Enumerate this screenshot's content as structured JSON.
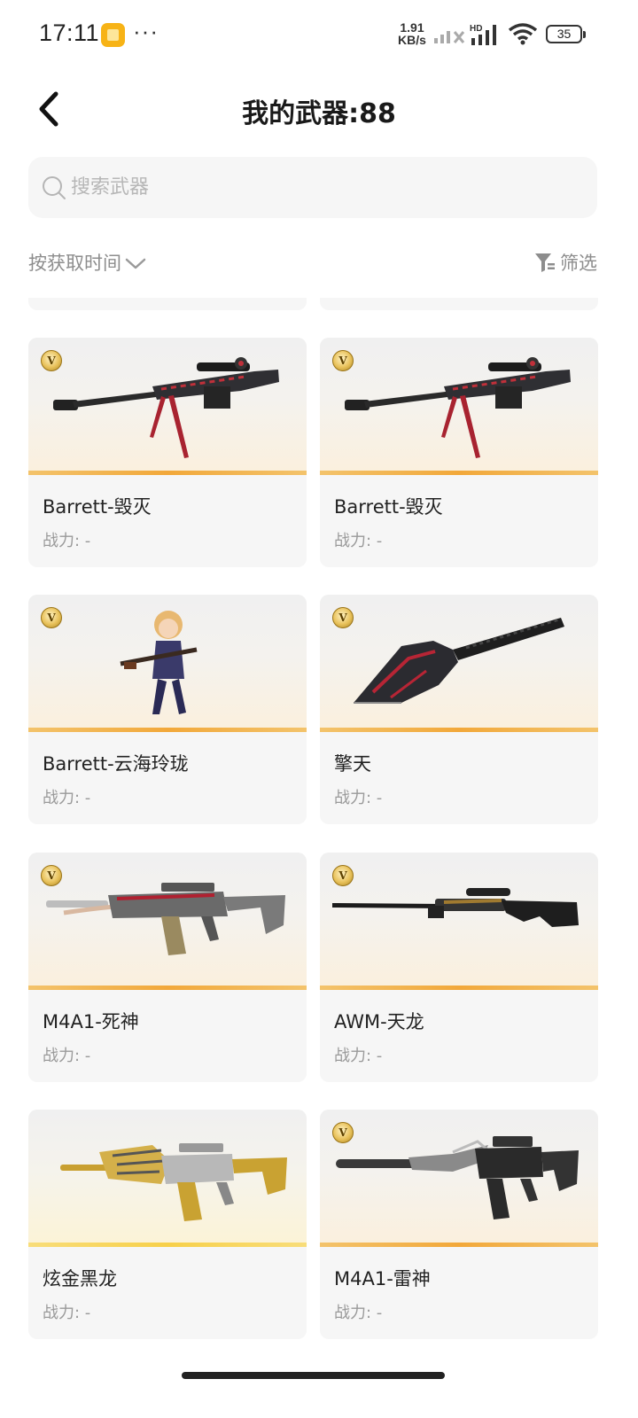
{
  "status_bar": {
    "time": "17:11",
    "net_speed_value": "1.91",
    "net_speed_unit": "KB/s",
    "signal_label": "HD",
    "battery": "35"
  },
  "header": {
    "title": "我的武器:88",
    "back_icon": "chevron-left-icon"
  },
  "search": {
    "placeholder": "搜索武器",
    "value": ""
  },
  "toolbar": {
    "sort_label": "按获取时间",
    "filter_label": "筛选"
  },
  "colors": {
    "accent_bar": "#f2a83a",
    "accent_bar_gold": "#f7d04a",
    "card_bg": "#f6f6f6",
    "muted_text": "#8d8d8d"
  },
  "weapons": [
    {
      "name": "Barrett-毁灭",
      "power": "战力: -",
      "badge": "V",
      "art": "barrett-sniper-icon"
    },
    {
      "name": "Barrett-毁灭",
      "power": "战力: -",
      "badge": "V",
      "art": "barrett-sniper-icon"
    },
    {
      "name": "Barrett-云海玲珑",
      "power": "战力: -",
      "badge": "V",
      "art": "character-with-sniper-icon"
    },
    {
      "name": "擎天",
      "power": "战力: -",
      "badge": "V",
      "art": "shovel-melee-icon"
    },
    {
      "name": "M4A1-死神",
      "power": "战力: -",
      "badge": "V",
      "art": "assault-rifle-icon"
    },
    {
      "name": "AWM-天龙",
      "power": "战力: -",
      "badge": "V",
      "art": "awm-sniper-icon"
    },
    {
      "name": "炫金黑龙",
      "power": "战力: -",
      "badge": "",
      "art": "gold-dragon-rifle-icon"
    },
    {
      "name": "M4A1-雷神",
      "power": "战力: -",
      "badge": "V",
      "art": "silenced-rifle-icon"
    }
  ]
}
